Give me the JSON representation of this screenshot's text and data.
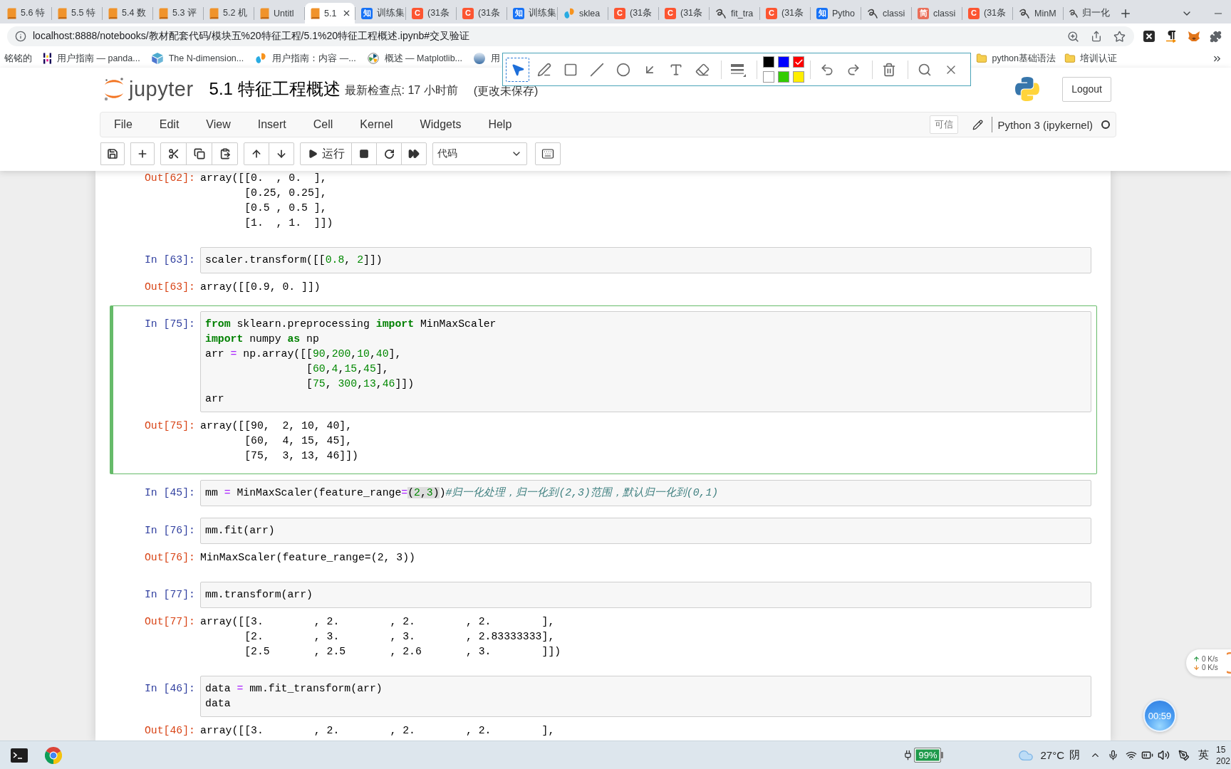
{
  "browser": {
    "tabs": [
      {
        "title": "5.6 特",
        "kind": "book",
        "selected": false
      },
      {
        "title": "5.5 特",
        "kind": "book",
        "selected": false
      },
      {
        "title": "5.4 数",
        "kind": "book",
        "selected": false
      },
      {
        "title": "5.3 评",
        "kind": "book",
        "selected": false
      },
      {
        "title": "5.2 机",
        "kind": "book",
        "selected": false
      },
      {
        "title": "Untitl",
        "kind": "book",
        "selected": false
      },
      {
        "title": "5.1",
        "kind": "book",
        "selected": true
      },
      {
        "title": "训练集",
        "kind": "badge",
        "badge": "知",
        "color": "#1772f6",
        "selected": false
      },
      {
        "title": "(31条",
        "kind": "badge",
        "badge": "C",
        "color": "#fc5531",
        "selected": false
      },
      {
        "title": "(31条",
        "kind": "badge",
        "badge": "C",
        "color": "#fc5531",
        "selected": false
      },
      {
        "title": "训练集",
        "kind": "badge",
        "badge": "知",
        "color": "#1772f6",
        "selected": false
      },
      {
        "title": "sklea",
        "kind": "blobs",
        "selected": false
      },
      {
        "title": "(31条",
        "kind": "badge",
        "badge": "C",
        "color": "#fc5531",
        "selected": false
      },
      {
        "title": "(31条",
        "kind": "badge",
        "badge": "C",
        "color": "#fc5531",
        "selected": false
      },
      {
        "title": "fit_tra",
        "kind": "scribble",
        "selected": false
      },
      {
        "title": "(31条",
        "kind": "badge",
        "badge": "C",
        "color": "#fc5531",
        "selected": false
      },
      {
        "title": "Pytho",
        "kind": "badge",
        "badge": "知",
        "color": "#1772f6",
        "selected": false
      },
      {
        "title": "classi",
        "kind": "scribble",
        "selected": false
      },
      {
        "title": "classi",
        "kind": "badge",
        "badge": "简",
        "color": "#ea6f5a",
        "selected": false
      },
      {
        "title": "(31条",
        "kind": "badge",
        "badge": "C",
        "color": "#fc5531",
        "selected": false
      },
      {
        "title": "MinM",
        "kind": "scribble",
        "selected": false
      },
      {
        "title": "归一化",
        "kind": "scribble",
        "selected": false
      }
    ],
    "address": "localhost:8888/notebooks/教材配套代码/模块五%20特征工程/5.1%20特征工程概述.ipynb#交叉验证",
    "bookmarks": [
      {
        "title": "铭铭的"
      },
      {
        "title": "用户指南 — panda...",
        "kind": "bars"
      },
      {
        "title": "The N-dimension...",
        "kind": "cube"
      },
      {
        "title": "用户指南：内容 —...",
        "kind": "blobs"
      },
      {
        "title": "概述 — Matplotlib...",
        "kind": "radial"
      },
      {
        "title": "用",
        "kind": "sphere"
      }
    ],
    "bookmark_folders": [
      "python基础语法",
      "培训认证"
    ]
  },
  "annotation_toolbar": {
    "tools": [
      {
        "kind": "pointer",
        "selected": true
      },
      {
        "kind": "pen",
        "selected": false
      },
      {
        "kind": "rectangle",
        "selected": false
      },
      {
        "kind": "line",
        "selected": false
      },
      {
        "kind": "ellipse",
        "selected": false
      },
      {
        "kind": "arrow",
        "selected": false
      },
      {
        "kind": "text",
        "selected": false
      },
      {
        "kind": "eraser",
        "selected": false
      },
      {
        "kind": "stroke",
        "selected": false
      }
    ],
    "swatches": [
      {
        "color": "#000000",
        "selected": false
      },
      {
        "color": "#0000ff",
        "selected": false
      },
      {
        "color": "#ff0000",
        "selected": true
      },
      {
        "color": "#ffffff",
        "selected": false
      },
      {
        "color": "#33cc00",
        "selected": false
      },
      {
        "color": "#ffee00",
        "selected": false
      }
    ]
  },
  "notebook_header": {
    "logo_text": "jupyter",
    "title": "5.1 特征工程概述",
    "checkpoint": "最新检查点: 17 小时前",
    "unsaved": "(更改未保存)",
    "logout": "Logout"
  },
  "menu": {
    "items": [
      "File",
      "Edit",
      "View",
      "Insert",
      "Cell",
      "Kernel",
      "Widgets",
      "Help"
    ],
    "trusted": "可信",
    "kernel": "Python 3 (ipykernel)",
    "kernel_busy": false
  },
  "toolbar": {
    "run_label": "运行",
    "cell_type": "代码"
  },
  "cells": [
    {
      "selected": false,
      "out_prompt": "Out[62]:",
      "output": [
        "array([[0.  , 0.  ],",
        "       [0.25, 0.25],",
        "       [0.5 , 0.5 ],",
        "       [1.  , 1.  ]])"
      ]
    },
    {
      "selected": false,
      "in_prompt": "In [63]:",
      "code": [
        [
          {
            "text": "scaler.transform([[",
            "kind": "plain"
          },
          {
            "text": "0.8",
            "kind": "number"
          },
          {
            "text": ", ",
            "kind": "plain"
          },
          {
            "text": "2",
            "kind": "number"
          },
          {
            "text": "]])",
            "kind": "plain"
          }
        ]
      ],
      "out_prompt": "Out[63]:",
      "output": [
        "array([[0.9, 0. ]])"
      ]
    },
    {
      "selected": true,
      "in_prompt": "In [75]:",
      "code": [
        [
          {
            "text": "from",
            "kind": "keyword"
          },
          {
            "text": " sklearn.preprocessing ",
            "kind": "plain"
          },
          {
            "text": "import",
            "kind": "keyword"
          },
          {
            "text": " MinMaxScaler",
            "kind": "plain"
          }
        ],
        [
          {
            "text": "import",
            "kind": "keyword"
          },
          {
            "text": " numpy ",
            "kind": "plain"
          },
          {
            "text": "as",
            "kind": "keyword"
          },
          {
            "text": " np",
            "kind": "plain"
          }
        ],
        [
          {
            "text": "arr ",
            "kind": "plain"
          },
          {
            "text": "=",
            "kind": "operator"
          },
          {
            "text": " np.array([[",
            "kind": "plain"
          },
          {
            "text": "90",
            "kind": "number"
          },
          {
            "text": ",",
            "kind": "plain"
          },
          {
            "text": "200",
            "kind": "number"
          },
          {
            "text": ",",
            "kind": "plain"
          },
          {
            "text": "10",
            "kind": "number"
          },
          {
            "text": ",",
            "kind": "plain"
          },
          {
            "text": "40",
            "kind": "number"
          },
          {
            "text": "],",
            "kind": "plain"
          }
        ],
        [
          {
            "text": "                [",
            "kind": "plain"
          },
          {
            "text": "60",
            "kind": "number"
          },
          {
            "text": ",",
            "kind": "plain"
          },
          {
            "text": "4",
            "kind": "number"
          },
          {
            "text": ",",
            "kind": "plain"
          },
          {
            "text": "15",
            "kind": "number"
          },
          {
            "text": ",",
            "kind": "plain"
          },
          {
            "text": "45",
            "kind": "number"
          },
          {
            "text": "],",
            "kind": "plain"
          }
        ],
        [
          {
            "text": "                [",
            "kind": "plain"
          },
          {
            "text": "75",
            "kind": "number"
          },
          {
            "text": ", ",
            "kind": "plain"
          },
          {
            "text": "300",
            "kind": "number"
          },
          {
            "text": ",",
            "kind": "plain"
          },
          {
            "text": "13",
            "kind": "number"
          },
          {
            "text": ",",
            "kind": "plain"
          },
          {
            "text": "46",
            "kind": "number"
          },
          {
            "text": "]])",
            "kind": "plain"
          }
        ],
        [
          {
            "text": "arr",
            "kind": "plain"
          }
        ]
      ],
      "out_prompt": "Out[75]:",
      "output": [
        "array([[90,  2, 10, 40],",
        "       [60,  4, 15, 45],",
        "       [75,  3, 13, 46]])"
      ]
    },
    {
      "selected": false,
      "in_prompt": "In [45]:",
      "code": [
        [
          {
            "text": "mm ",
            "kind": "plain"
          },
          {
            "text": "=",
            "kind": "operator"
          },
          {
            "text": " MinMaxScaler(feature_range",
            "kind": "plain"
          },
          {
            "text": "=",
            "kind": "operator"
          },
          {
            "text": "(",
            "kind": "match"
          },
          {
            "text": "2",
            "kind": "match_number"
          },
          {
            "text": ",",
            "kind": "match"
          },
          {
            "text": "3",
            "kind": "match_number"
          },
          {
            "text": ")",
            "kind": "match"
          },
          {
            "text": ")",
            "kind": "plain"
          },
          {
            "text": "#归一化处理，归一化到(2,3)范围，默认归一化到(0,1)",
            "kind": "comment"
          }
        ]
      ]
    },
    {
      "selected": false,
      "in_prompt": "In [76]:",
      "code": [
        [
          {
            "text": "mm.fit(arr)",
            "kind": "plain"
          }
        ]
      ],
      "out_prompt": "Out[76]:",
      "output": [
        "MinMaxScaler(feature_range=(2, 3))"
      ]
    },
    {
      "selected": false,
      "in_prompt": "In [77]:",
      "code": [
        [
          {
            "text": "mm.transform(arr)",
            "kind": "plain"
          }
        ]
      ],
      "out_prompt": "Out[77]:",
      "output": [
        "array([[3.        , 2.        , 2.        , 2.        ],",
        "       [2.        , 3.        , 3.        , 2.83333333],",
        "       [2.5       , 2.5       , 2.6       , 3.        ]])"
      ]
    },
    {
      "selected": false,
      "in_prompt": "In [46]:",
      "code": [
        [
          {
            "text": "data ",
            "kind": "plain"
          },
          {
            "text": "=",
            "kind": "operator"
          },
          {
            "text": " mm.fit_transform(arr)",
            "kind": "plain"
          }
        ],
        [
          {
            "text": "data",
            "kind": "plain"
          }
        ]
      ],
      "out_prompt": "Out[46]:",
      "output": [
        "array([[3.        , 2.        , 2.        , 2.        ],"
      ]
    }
  ],
  "floating": {
    "net_speed": [
      {
        "kind": "up",
        "text": "0 K/s"
      },
      {
        "kind": "down",
        "text": "0 K/s"
      }
    ],
    "timer": "00:59"
  },
  "taskbar": {
    "battery": "99%",
    "temperature": "27°C",
    "weather": "阴",
    "ime": "英",
    "clock": [
      "15",
      "202"
    ]
  }
}
